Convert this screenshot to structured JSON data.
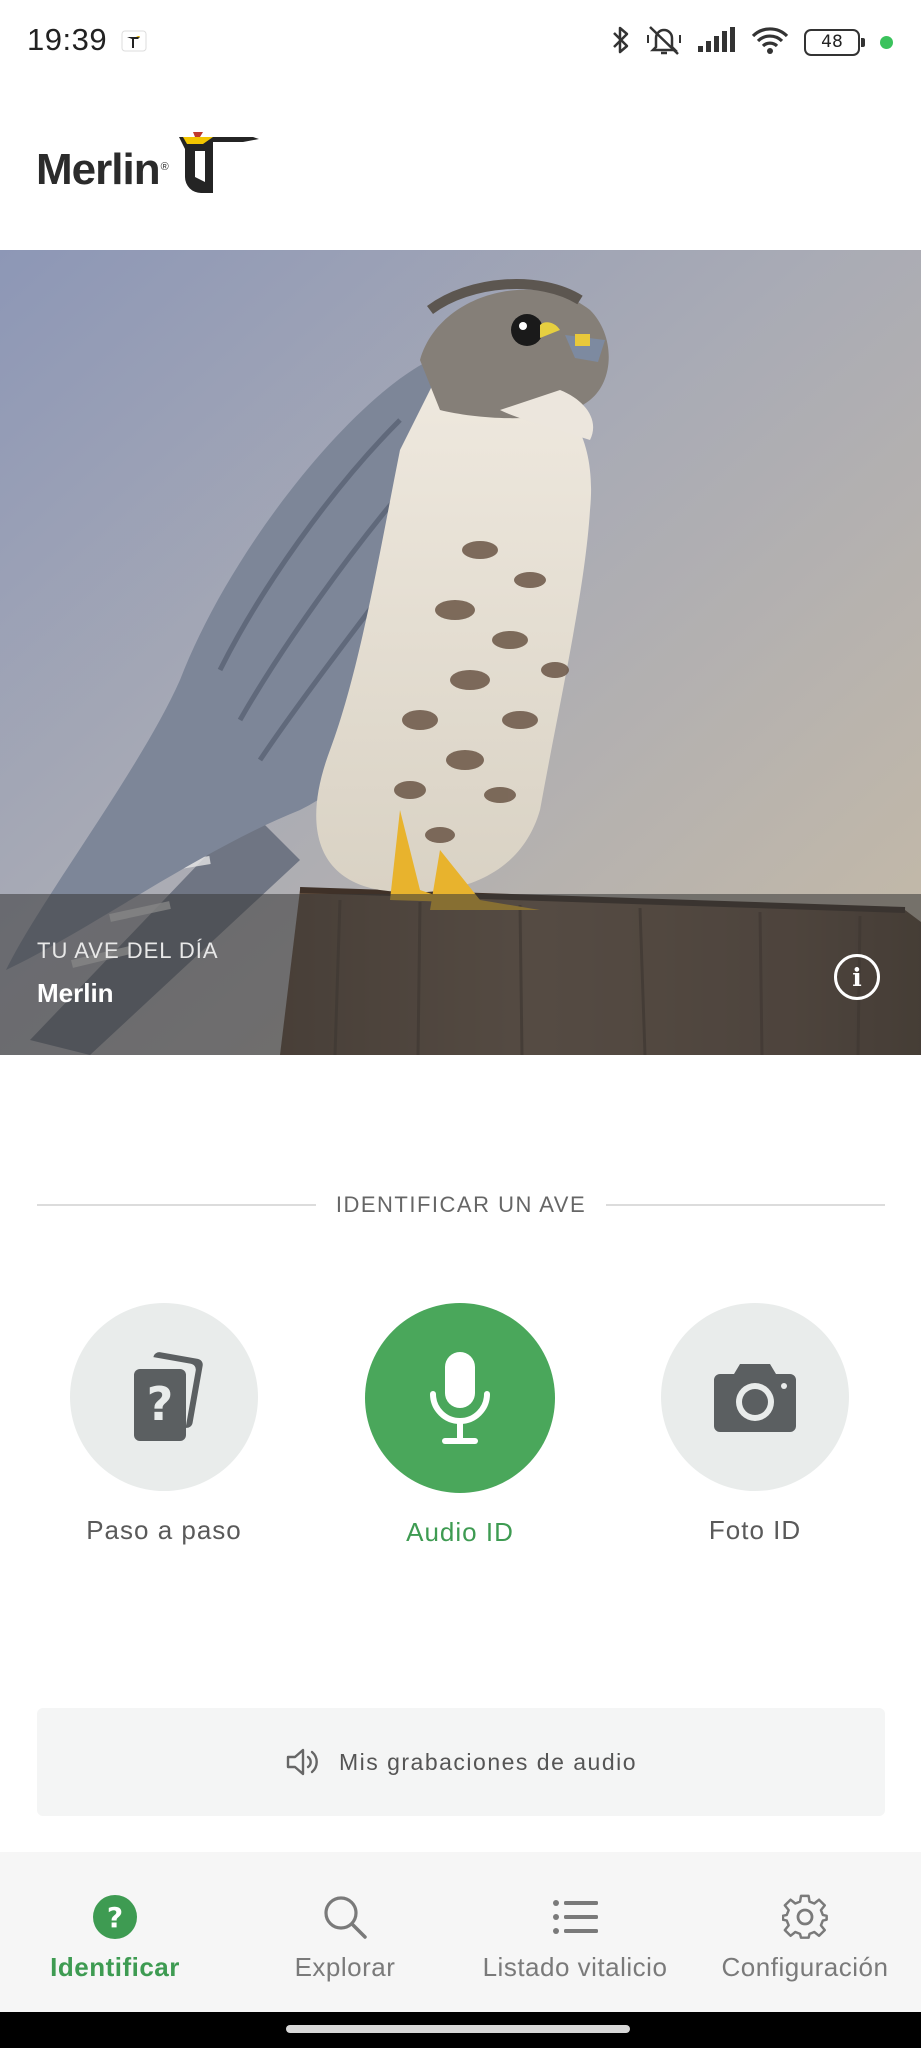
{
  "status_bar": {
    "time": "19:39",
    "battery": "48",
    "icons": [
      "bluetooth-icon",
      "mute-vibrate-icon",
      "signal-icon",
      "wifi-icon",
      "battery-icon"
    ],
    "dot_color": "#3ac25c"
  },
  "header": {
    "logo_text": "Merlin",
    "logo_reg": "®"
  },
  "hero": {
    "kicker": "TU AVE DEL DÍA",
    "title": "Merlin"
  },
  "identify": {
    "section_title": "IDENTIFICAR UN AVE",
    "options": [
      {
        "label": "Paso a paso",
        "icon": "question-cards-icon"
      },
      {
        "label": "Audio ID",
        "icon": "microphone-icon"
      },
      {
        "label": "Foto ID",
        "icon": "camera-icon"
      }
    ]
  },
  "recordings": {
    "label": "Mis grabaciones de audio",
    "icon": "speaker-icon"
  },
  "bottom_nav": {
    "items": [
      {
        "label": "Identificar",
        "icon": "question-circle-icon"
      },
      {
        "label": "Explorar",
        "icon": "search-icon"
      },
      {
        "label": "Listado vitalicio",
        "icon": "list-icon"
      },
      {
        "label": "Configuración",
        "icon": "gear-icon"
      }
    ]
  },
  "colors": {
    "accent_green": "#4aa75b",
    "accent_text_green": "#3e9b52",
    "option_bg": "#e9eceb"
  }
}
